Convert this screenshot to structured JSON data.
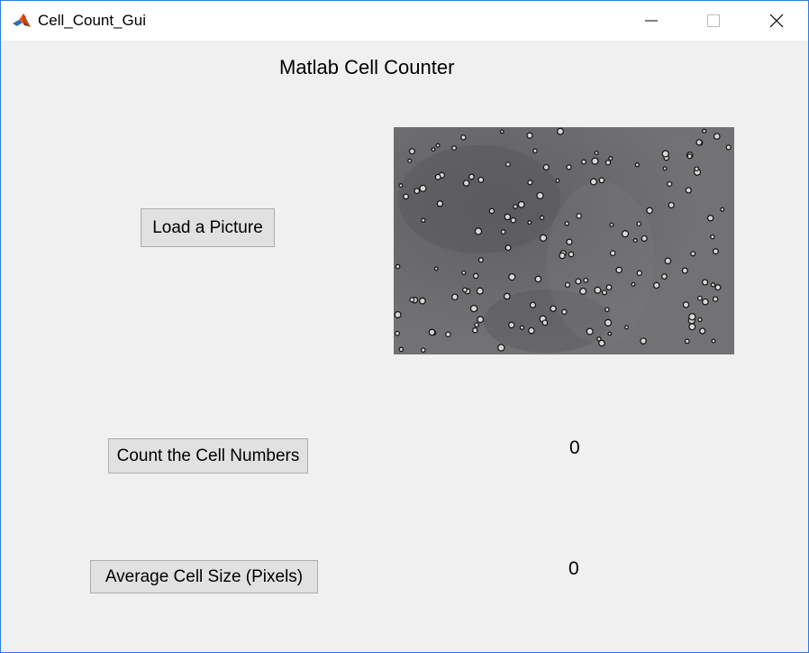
{
  "window": {
    "title": "Cell_Count_Gui",
    "icon": "matlab-logo-icon",
    "controls": [
      "minimize-icon",
      "maximize-icon",
      "close-icon"
    ]
  },
  "main": {
    "heading": "Matlab Cell Counter",
    "buttons": {
      "load": "Load a Picture",
      "count": "Count the Cell Numbers",
      "average": "Average Cell Size (Pixels)"
    },
    "values": {
      "cell_count": "0",
      "average_size": "0"
    },
    "image": {
      "icon": "microscope-cell-image",
      "background_color": "#6b6b6e"
    }
  },
  "colors": {
    "window_border": "#2b7fd9",
    "window_background": "#f0f0f0",
    "button_face": "#e1e1e1",
    "button_border": "#adadad"
  }
}
